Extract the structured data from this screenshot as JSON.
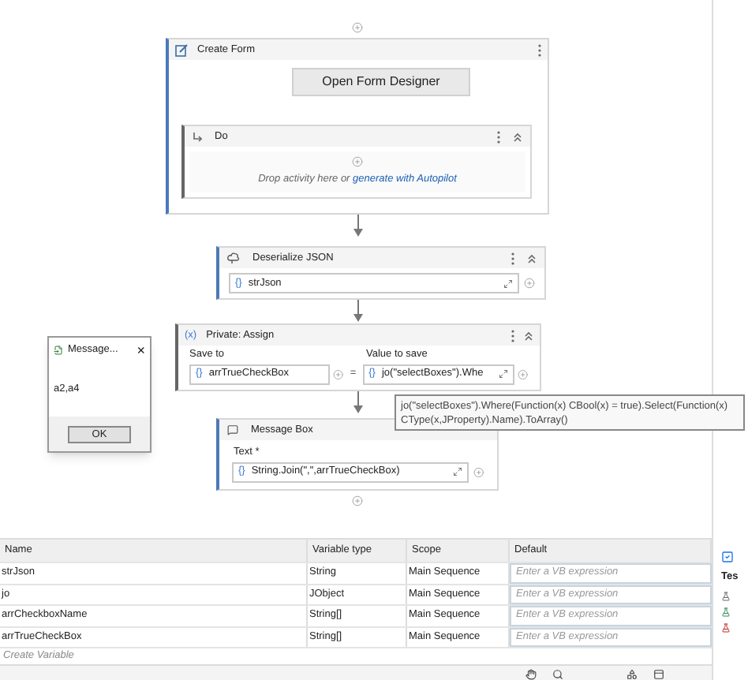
{
  "create_form": {
    "title": "Create Form",
    "button": "Open Form Designer",
    "do": {
      "title": "Do",
      "hint": "Drop activity here or ",
      "link": "generate with Autopilot"
    }
  },
  "deserialize_json": {
    "title": "Deserialize JSON",
    "field": {
      "prefix": "{}",
      "value": "strJson"
    }
  },
  "assign": {
    "title": "Private: Assign",
    "prefix": "(x)",
    "save_to_label": "Save to",
    "save_to": {
      "prefix": "{}",
      "value": "arrTrueCheckBox"
    },
    "equals": "=",
    "value_label": "Value to save",
    "value": {
      "prefix": "{}",
      "value": "jo(\"selectBoxes\").Whe"
    }
  },
  "tooltip": {
    "text": "jo(\"selectBoxes\").Where(Function(x)  CBool(x) = true).Select(Function(x) CType(x,JProperty).Name).ToArray()"
  },
  "message_box": {
    "title": "Message Box",
    "text_label": "Text *",
    "field": {
      "prefix": "{}",
      "value": "String.Join(\",\",arrTrueCheckBox)"
    }
  },
  "message_dialog": {
    "title": "Message...",
    "close": "×",
    "body": "a2,a4",
    "button": "OK"
  },
  "variables": {
    "columns": [
      "Name",
      "Variable type",
      "Scope",
      "Default"
    ],
    "rows": [
      {
        "name": "strJson",
        "type": "String",
        "scope": "Main Sequence",
        "placeholder": "Enter a VB expression"
      },
      {
        "name": "jo",
        "type": "JObject",
        "scope": "Main Sequence",
        "placeholder": "Enter a VB expression"
      },
      {
        "name": "arrCheckboxName",
        "type": "String[]",
        "scope": "Main Sequence",
        "placeholder": "Enter a VB expression"
      },
      {
        "name": "arrTrueCheckBox",
        "type": "String[]",
        "scope": "Main Sequence",
        "placeholder": "Enter a VB expression"
      }
    ],
    "create": "Create Variable"
  },
  "side_panel": {
    "label": "Tes"
  }
}
